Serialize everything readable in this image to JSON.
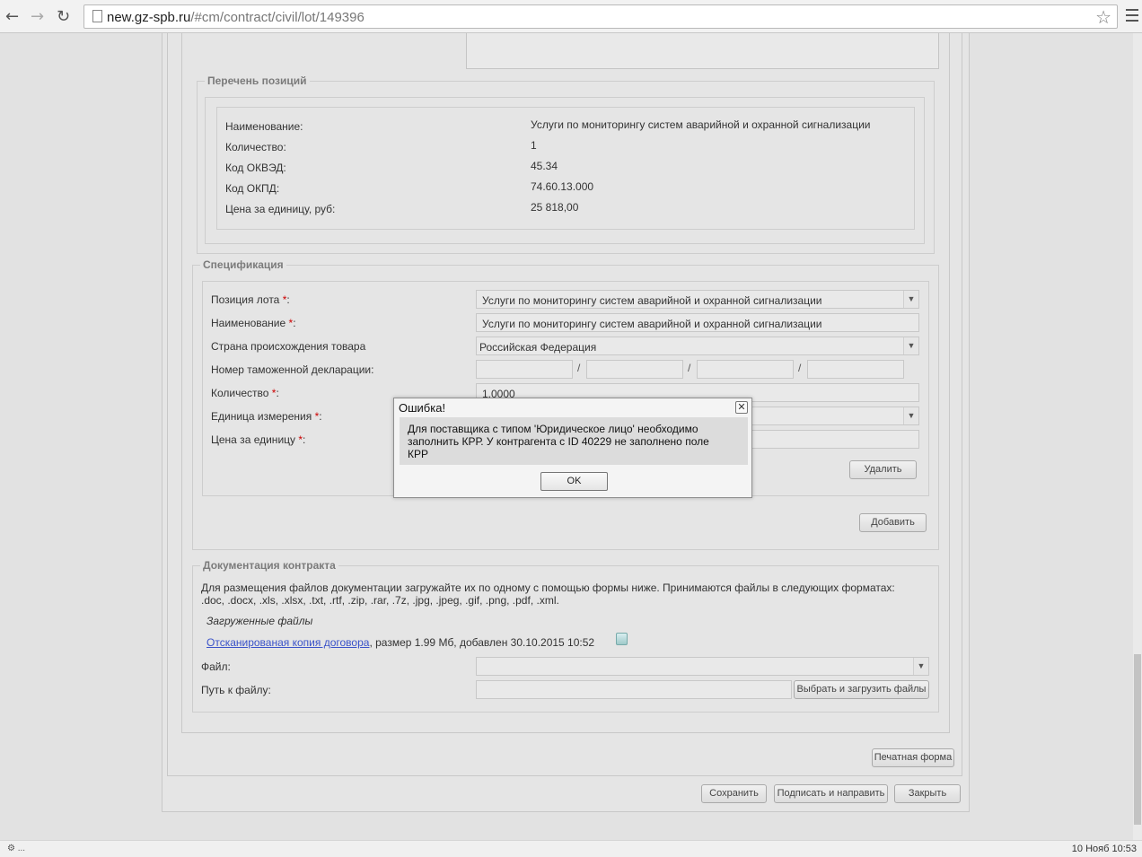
{
  "browser": {
    "url_host": "new.gz-spb.ru",
    "url_path": "/#cm/contract/civil/lot/149396"
  },
  "positions": {
    "legend": "Перечень позиций",
    "rows": [
      {
        "label": "Наименование:",
        "value": "Услуги по мониторингу систем аварийной и охранной сигнализации"
      },
      {
        "label": "Количество:",
        "value": "1"
      },
      {
        "label": "Код ОКВЭД:",
        "value": "45.34"
      },
      {
        "label": "Код ОКПД:",
        "value": "74.60.13.000"
      },
      {
        "label": "Цена за единицу, руб:",
        "value": "25 818,00"
      }
    ]
  },
  "spec": {
    "legend": "Спецификация",
    "lot_position_label": "Позиция лота",
    "lot_position_value": "Услуги по мониторингу систем аварийной и охранной сигнализации",
    "name_label": "Наименование",
    "name_value": "Услуги по мониторингу систем аварийной и охранной сигнализации",
    "country_label": "Страна происхождения товара",
    "country_value": "Российская Федерация",
    "customs_label": "Номер таможенной декларации:",
    "quantity_label": "Количество",
    "quantity_value": "1.0000",
    "unit_label": "Единица измерения",
    "price_label": "Цена за единицу",
    "required_mark": "*",
    "colon": ":",
    "slash": "/",
    "delete_button": "Удалить",
    "add_button": "Добавить"
  },
  "docs": {
    "legend": "Документация контракта",
    "info_line1": "Для размещения файлов документации загружайте их по одному с помощью формы ниже. Принимаются файлы в следующих форматах:",
    "info_line2": ".doc, .docx, .xls, .xlsx, .txt, .rtf, .zip, .rar, .7z, .jpg, .jpeg, .gif, .png, .pdf, .xml.",
    "uploaded_heading": "Загруженные файлы",
    "file_link": "Отсканированая копия договора",
    "file_meta": ", размер 1.99 Мб, добавлен 30.10.2015 10:52",
    "file_label": "Файл:",
    "path_label": "Путь к файлу:",
    "upload_button": "Выбрать и загрузить файлы"
  },
  "footer": {
    "print_button": "Печатная форма",
    "save_button": "Сохранить",
    "sign_button": "Подписать и направить",
    "close_button": "Закрыть"
  },
  "dialog": {
    "title": "Ошибка!",
    "close_glyph": "✕",
    "message_line1": "Для поставщика с типом 'Юридическое лицо' необходимо",
    "message_line2": "заполнить КРР. У контрагента с ID 40229 не заполнено поле",
    "message_line3": "КРР",
    "ok_button": "OK"
  },
  "statusbar": {
    "left": "⚙ ...",
    "right": "10 Нояб 10:53"
  }
}
